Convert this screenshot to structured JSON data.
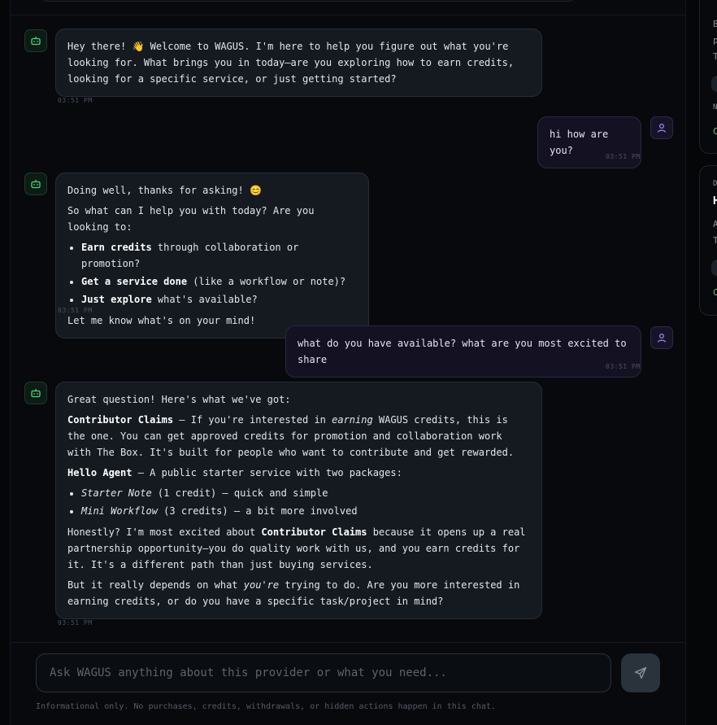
{
  "messages": {
    "m1": {
      "text": "Hey there! 👋 Welcome to WAGUS. I'm here to help you figure out what you're looking for. What brings you in today—are you exploring how to earn credits, looking for a specific service, or just getting started?",
      "time": "03:51 PM"
    },
    "m2": {
      "text": "hi how are you?",
      "time": "03:51 PM"
    },
    "m3": {
      "p1": "Doing well, thanks for asking! 😊",
      "p2": "So what can I help you with today? Are you looking to:",
      "b1_bold": "Earn credits",
      "b1_rest": " through collaboration or promotion?",
      "b2_bold": "Get a service done",
      "b2_rest": " (like a workflow or note)?",
      "b3_bold": "Just explore",
      "b3_rest": " what's available?",
      "p3": "Let me know what's on your mind!",
      "time": "03:51 PM"
    },
    "m4": {
      "text": "what do you have available? what are you most excited to share",
      "time": "03:51 PM"
    },
    "m5": {
      "p1": "Great question! Here's what we've got:",
      "p2_bold": "Contributor Claims",
      "p2_a": " – If you're interested in ",
      "p2_em": "earning",
      "p2_b": " WAGUS credits, this is the one. You can get approved credits for promotion and collaboration work with The Box. It's built for people who want to contribute and get rewarded.",
      "p3_bold": "Hello Agent",
      "p3_rest": " – A public starter service with two packages:",
      "li1_em": "Starter Note",
      "li1_rest": " (1 credit) – quick and simple",
      "li2_em": "Mini Workflow",
      "li2_rest": " (3 credits) – a bit more involved",
      "p4_a": "Honestly? I'm most excited about ",
      "p4_bold": "Contributor Claims",
      "p4_b": " because it opens up a real partnership opportunity—you do quality work with us, and you earn credits for it. It's a different path than just buying services.",
      "p5_a": "But it really depends on what ",
      "p5_em": "you're",
      "p5_b": " trying to do. Are you more interested in earning credits, or do you have a specific task/project in mind?",
      "time": "03:51 PM"
    }
  },
  "composer": {
    "placeholder": "Ask WAGUS anything about this provider or what you need...",
    "disclaimer": "Informational only. No purchases, credits, withdrawals, or hidden actions happen in this chat."
  },
  "sidebar": {
    "card1": {
      "c1": "B",
      "c2": "p",
      "c3": "T",
      "c4": "N",
      "c5": "C"
    },
    "card2": {
      "c0": "D",
      "title": "H",
      "c1": "A",
      "c2": "T",
      "c3": "C"
    }
  },
  "colors": {
    "bot_accent": "#4fd27a",
    "user_accent": "#9b8cf0",
    "status_green": "#4fd27a"
  }
}
